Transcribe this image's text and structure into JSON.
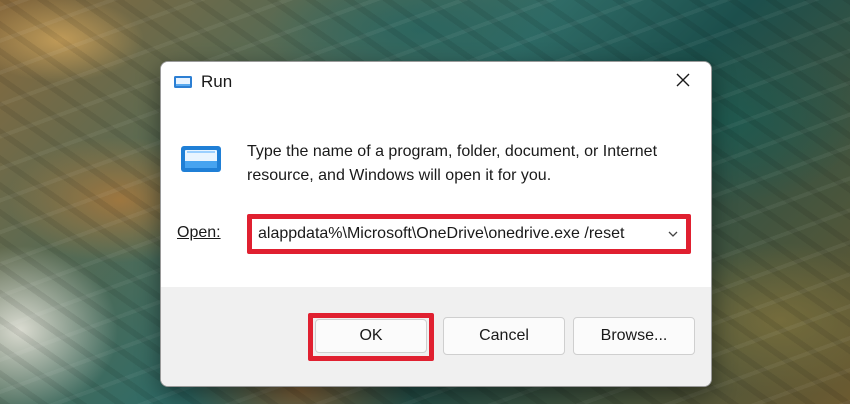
{
  "window": {
    "title": "Run",
    "icon": "run-icon",
    "close_icon": "close-icon"
  },
  "dialog": {
    "description": "Type the name of a program, folder, document, or Internet resource, and Windows will open it for you.",
    "open_label": "Open:",
    "open_value": "alappdata%\\Microsoft\\OneDrive\\onedrive.exe /reset",
    "open_dropdown_icon": "chevron-down-icon"
  },
  "buttons": {
    "ok": "OK",
    "cancel": "Cancel",
    "browse": "Browse..."
  },
  "colors": {
    "highlight": "#e02030",
    "footer": "#f0f0f0"
  }
}
